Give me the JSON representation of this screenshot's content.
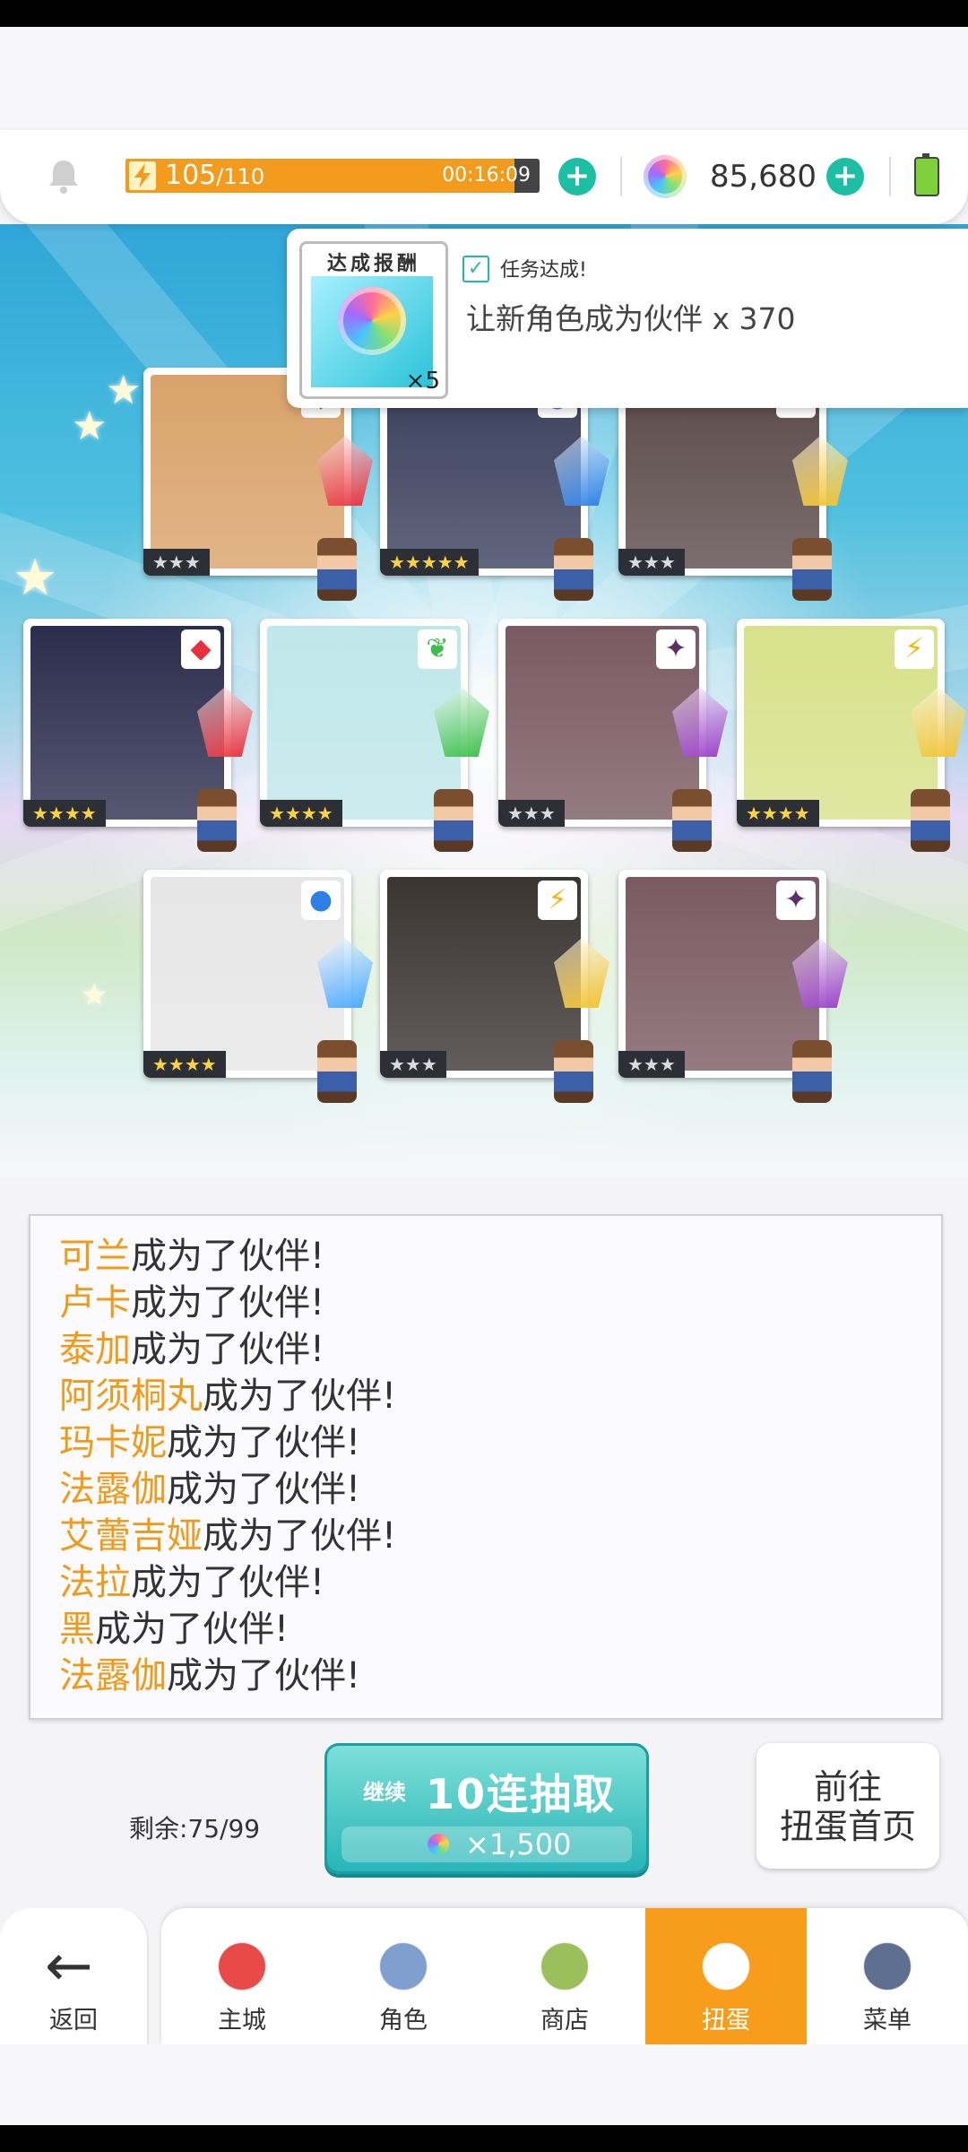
{
  "status": {
    "stamina_value": "105",
    "stamina_max": "/110",
    "stamina_fill_fraction": 0.94,
    "stamina_timer": "00:16:09",
    "gems": "85,680",
    "plus_symbol": "+"
  },
  "banner": {
    "reward_title": "达成报酬",
    "reward_qty": "×5",
    "check_mark": "✓",
    "mission_status": "任务达成!",
    "mission_desc": "让新角色成为伙伴  x 370"
  },
  "cards": [
    {
      "stars": "★★★",
      "stars_gold": false,
      "element": "fire",
      "element_color": "#e8303c",
      "gem_color": "#e8303c",
      "bg": "#d9a26a"
    },
    {
      "stars": "★★★★★",
      "stars_gold": true,
      "element": "water",
      "element_color": "#2e7fe6",
      "gem_color": "#2e7fe6",
      "bg": "#3a3f5c"
    },
    {
      "stars": "★★★",
      "stars_gold": false,
      "element": "thunder",
      "element_color": "#f2b705",
      "gem_color": "#f2c230",
      "bg": "#5b4a4a"
    },
    {
      "stars": "★★★★",
      "stars_gold": true,
      "element": "fire",
      "element_color": "#e8303c",
      "gem_color": "#e8303c",
      "bg": "#2c2d4d"
    },
    {
      "stars": "★★★★",
      "stars_gold": true,
      "element": "wind",
      "element_color": "#3bbf4a",
      "gem_color": "#3bbf4a",
      "bg": "#bfe7ea"
    },
    {
      "stars": "★★★",
      "stars_gold": false,
      "element": "dark",
      "element_color": "#5a2e6b",
      "gem_color": "#9b3fc7",
      "bg": "#7a5a62"
    },
    {
      "stars": "★★★★",
      "stars_gold": true,
      "element": "thunder",
      "element_color": "#f2b705",
      "gem_color": "#f2c230",
      "bg": "#d8e18a"
    },
    {
      "stars": "★★★★",
      "stars_gold": true,
      "element": "water",
      "element_color": "#2e7fe6",
      "gem_color": "#4aa8ff",
      "bg": "#e6e6e6"
    },
    {
      "stars": "★★★",
      "stars_gold": false,
      "element": "thunder",
      "element_color": "#f2b705",
      "gem_color": "#f2c230",
      "bg": "#3b3532"
    },
    {
      "stars": "★★★",
      "stars_gold": false,
      "element": "dark",
      "element_color": "#5a2e6b",
      "gem_color": "#9b3fc7",
      "bg": "#7a5a62"
    }
  ],
  "log": {
    "suffix": "成为了伙伴!",
    "names": [
      "可兰",
      "卢卡",
      "泰加",
      "阿须桐丸",
      "玛卡妮",
      "法露伽",
      "艾蕾吉娅",
      "法拉",
      "黑",
      "法露伽"
    ]
  },
  "actions": {
    "remaining": "剩余:75/99",
    "continue_label": "继续",
    "pull_label": "10连抽取",
    "pull_cost": "×1,500",
    "goto_line1": "前往",
    "goto_line2": "扭蛋首页"
  },
  "nav": {
    "back": "返回",
    "items": [
      "主城",
      "角色",
      "商店",
      "扭蛋",
      "菜单"
    ],
    "active_index": 3
  }
}
